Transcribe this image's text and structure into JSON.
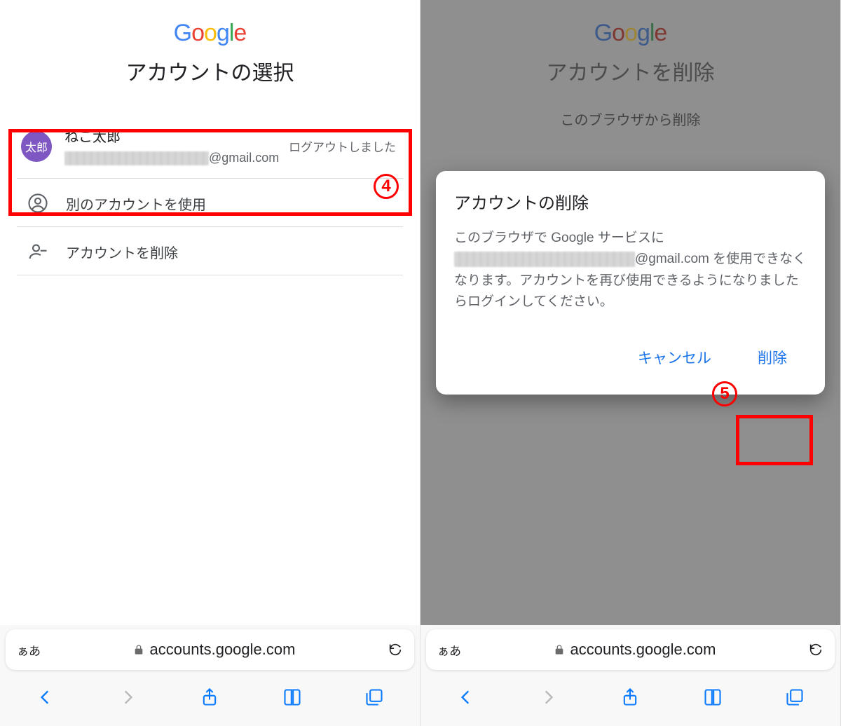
{
  "logo_letters": [
    "G",
    "o",
    "o",
    "g",
    "l",
    "e"
  ],
  "left": {
    "heading": "アカウントの選択",
    "account": {
      "name": "ねこ太郎",
      "avatar_text": "太郎",
      "email_suffix": "@gmail.com",
      "status": "ログアウトしました"
    },
    "use_other": "別のアカウントを使用",
    "delete_account": "アカウントを削除",
    "step_badge": "4",
    "address": {
      "aa": "ぁあ",
      "url": "accounts.google.com"
    }
  },
  "right": {
    "heading": "アカウントを削除",
    "subtext": "このブラウザから削除",
    "dialog": {
      "title": "アカウントの削除",
      "body_pre": "このブラウザで Google サービスに ",
      "email_suffix": "@gmail.com",
      "body_post": " を使用できなくなります。アカウントを再び使用できるようになりましたらログインしてください。",
      "cancel": "キャンセル",
      "confirm": "削除"
    },
    "step_badge": "5",
    "address": {
      "aa": "ぁあ",
      "url": "accounts.google.com"
    }
  }
}
